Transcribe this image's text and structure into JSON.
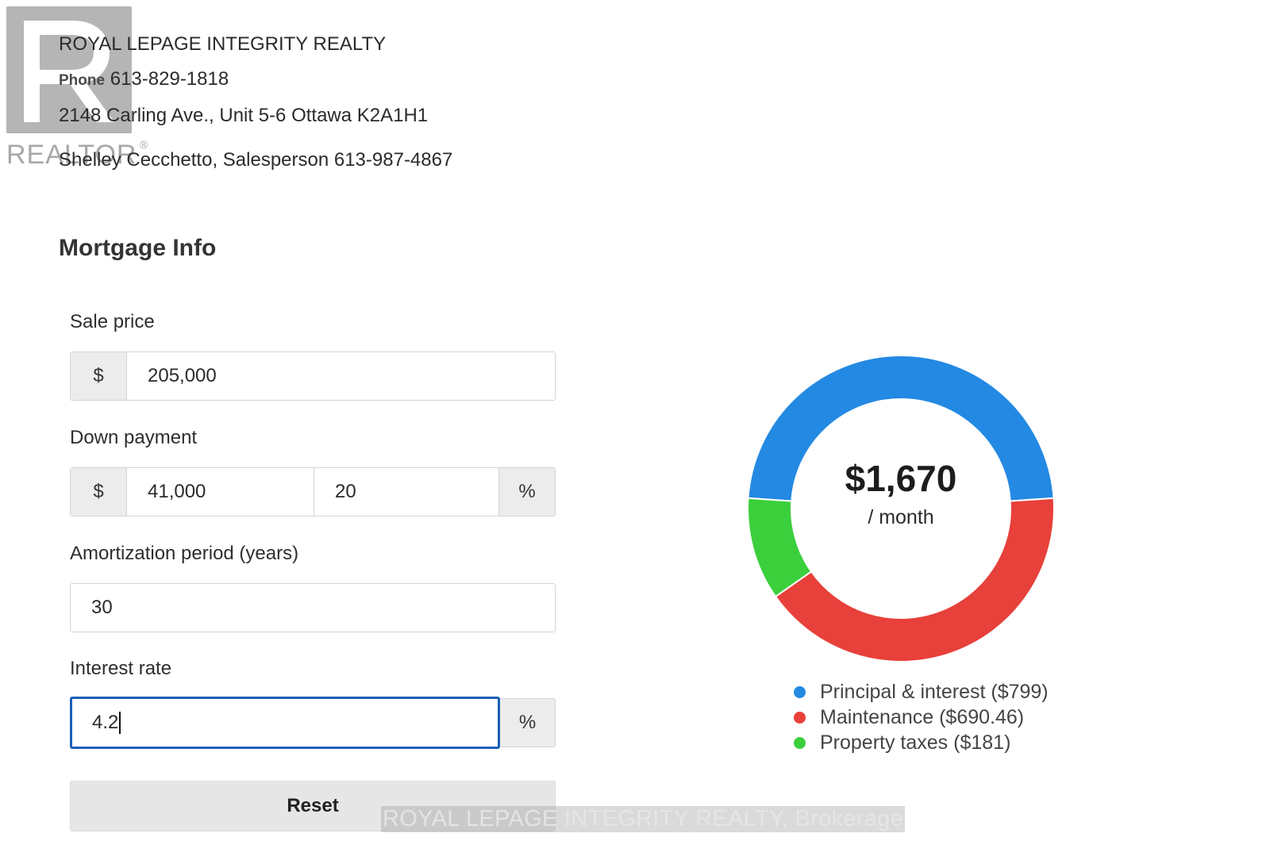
{
  "logo": {
    "word": "REALTOR",
    "reg": "®"
  },
  "agency": {
    "name": "ROYAL LEPAGE INTEGRITY REALTY",
    "phone_label": "Phone",
    "phone": "613-829-1818",
    "address": "2148 Carling Ave., Unit 5-6 Ottawa K2A1H1",
    "agent": "Shelley Cecchetto, Salesperson 613-987-4867"
  },
  "mortgage": {
    "title": "Mortgage Info",
    "sale_price": {
      "label": "Sale price",
      "prefix": "$",
      "value": "205,000"
    },
    "down_payment": {
      "label": "Down payment",
      "prefix": "$",
      "amount": "41,000",
      "percent": "20",
      "suffix": "%"
    },
    "amortization": {
      "label": "Amortization period (years)",
      "value": "30"
    },
    "interest": {
      "label": "Interest rate",
      "value": "4.2",
      "suffix": "%"
    },
    "reset_label": "Reset"
  },
  "watermark": "ROYAL LEPAGE INTEGRITY REALTY, Brokerage",
  "colors": {
    "principal": "#2389e3",
    "maintenance": "#e8403a",
    "taxes": "#3ccf3c",
    "focus": "#1c5fb7"
  },
  "summary": {
    "amount": "$1,670",
    "period": "/ month"
  },
  "chart_data": {
    "type": "pie",
    "categories": [
      "Principal & interest ($799)",
      "Maintenance ($690.46)",
      "Property taxes ($181)"
    ],
    "values": [
      799,
      690.46,
      181
    ],
    "colors": [
      "#2389e3",
      "#e8403a",
      "#3ccf3c"
    ],
    "legend": "bottom"
  }
}
